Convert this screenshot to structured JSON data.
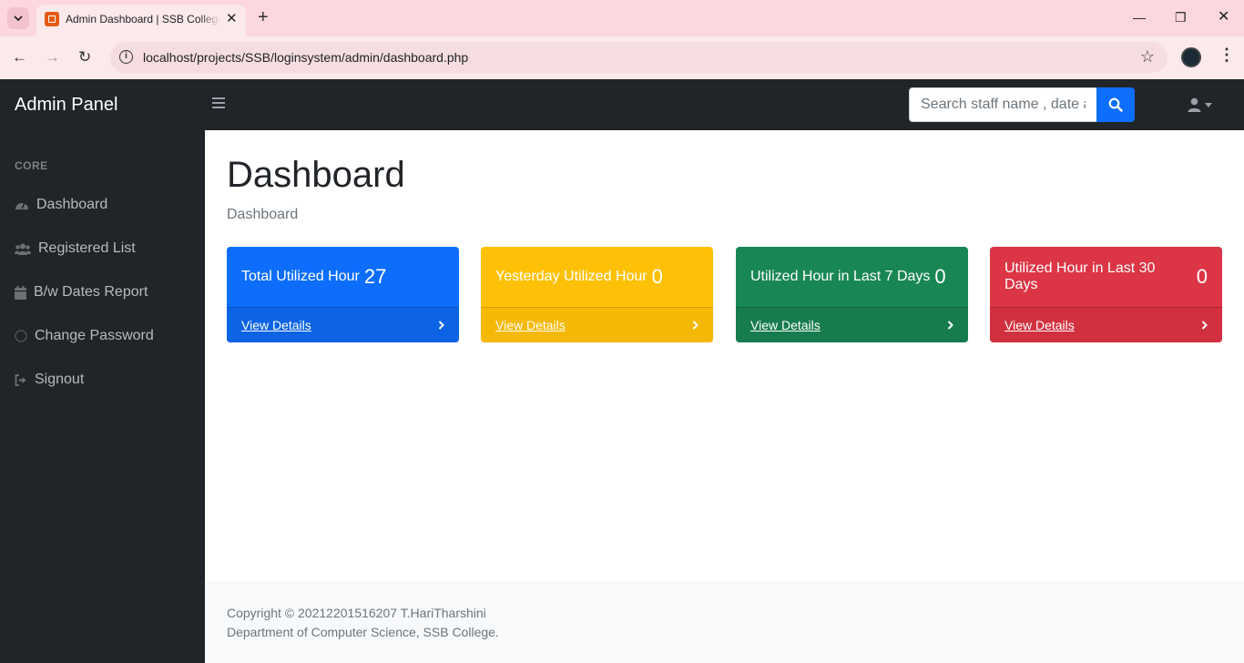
{
  "browser": {
    "tab_title": "Admin Dashboard | SSB College",
    "url": "localhost/projects/SSB/loginsystem/admin/dashboard.php"
  },
  "navbar": {
    "brand": "Admin Panel",
    "search_placeholder": "Search staff name , date a"
  },
  "sidebar": {
    "heading": "CORE",
    "items": [
      {
        "label": "Dashboard",
        "icon": "tachometer-icon"
      },
      {
        "label": "Registered List",
        "icon": "users-icon"
      },
      {
        "label": "B/w Dates Report",
        "icon": "calendar-icon"
      },
      {
        "label": "Change Password",
        "icon": "circle-icon"
      },
      {
        "label": "Signout",
        "icon": "sign-out-icon"
      }
    ]
  },
  "main": {
    "title": "Dashboard",
    "breadcrumb": "Dashboard",
    "cards": [
      {
        "label": "Total Utilized Hour",
        "value": "27",
        "link": "View Details",
        "color": "#0d6efd"
      },
      {
        "label": "Yesterday Utilized Hour",
        "value": "0",
        "link": "View Details",
        "color": "#ffc107"
      },
      {
        "label": "Utilized Hour in Last 7 Days",
        "value": "0",
        "link": "View Details",
        "color": "#198754"
      },
      {
        "label": "Utilized Hour in Last 30 Days",
        "value": "0",
        "link": "View Details",
        "color": "#dc3545"
      }
    ]
  },
  "footer": {
    "line1": "Copyright © 20212201516207 T.HariTharshini",
    "line2": "Department of Computer Science, SSB College."
  }
}
